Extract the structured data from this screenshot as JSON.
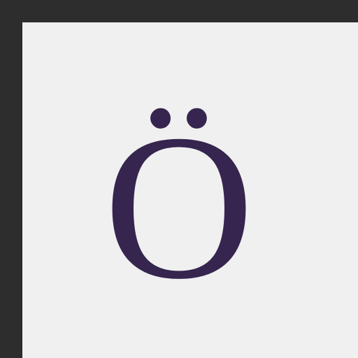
{
  "character": "Ö",
  "colors": {
    "frame": "#2d2d2d",
    "background": "#f0f0f0",
    "glyph": "#35254f"
  }
}
